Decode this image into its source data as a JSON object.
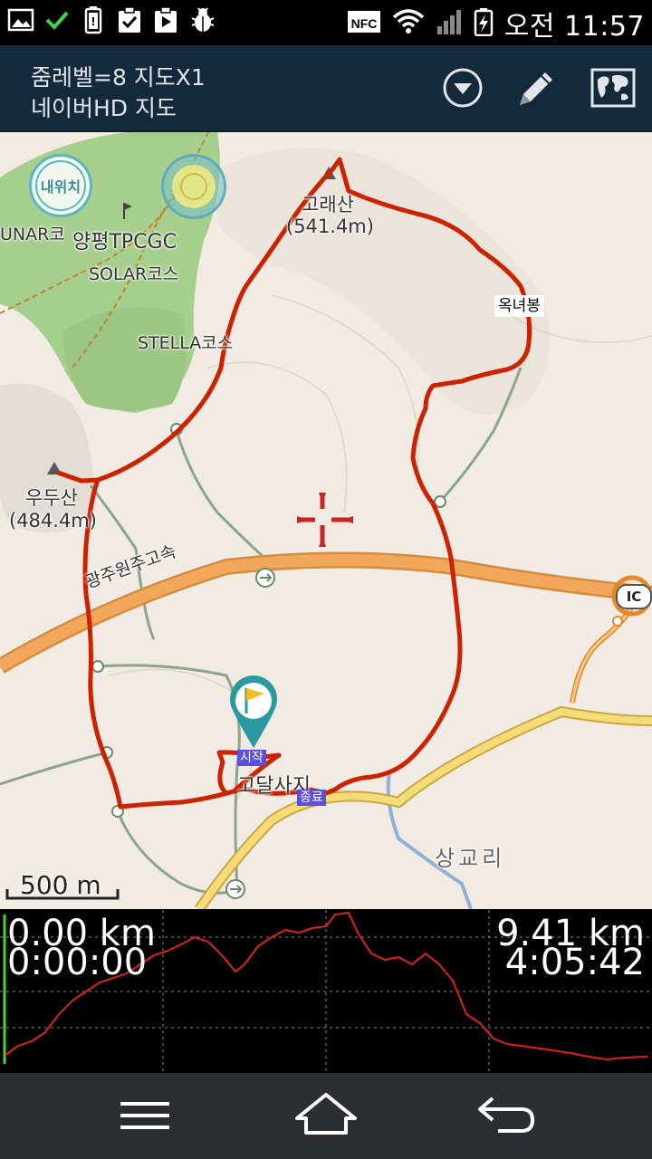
{
  "status_bar": {
    "time": "오전 11:57",
    "left_icons": [
      "image-icon",
      "check-icon",
      "battery-saver-icon",
      "clipboard-check-icon",
      "clipboard-play-icon",
      "bug-icon"
    ],
    "right_icons": [
      "nfc-icon",
      "wifi-icon",
      "signal-icon",
      "battery-charging-icon"
    ],
    "nfc_label": "NFC"
  },
  "titlebar": {
    "line1": "줌레벨=8 지도X1",
    "line2": "네이버HD 지도",
    "buttons": [
      "dropdown-icon",
      "pencil-icon",
      "world-map-icon"
    ]
  },
  "map": {
    "my_location_label": "내위치",
    "labels": {
      "golf_course": "양평TPCGC",
      "lunar_course": "UNAR코",
      "solar_course": "SOLAR코스",
      "stella_course": "STELLA코스",
      "peak1_name": "고래산",
      "peak1_elev": "(541.4m)",
      "peak2_name": "우두산",
      "peak2_elev": "(484.4m)",
      "peak3_name": "옥녀봉",
      "highway": "광주원주고속",
      "ic": "IC",
      "start_place": "고달사지",
      "village": "상교리"
    },
    "start_tag": "시작",
    "end_tag": "종료",
    "scale": "500 m"
  },
  "elevation": {
    "start_distance": "0.00 km",
    "start_time": "0:00:00",
    "end_distance": "9.41 km",
    "end_time": "4:05:42"
  },
  "navbar": {
    "buttons": [
      "menu-icon",
      "home-icon",
      "back-icon"
    ]
  },
  "colors": {
    "track": "#cc2200",
    "titlebar_bg": "#142a3a",
    "map_bg": "#f2ebe3",
    "forest": "#a6cf8e",
    "highway": "#f2a85c",
    "road_yellow": "#f5dc78"
  }
}
